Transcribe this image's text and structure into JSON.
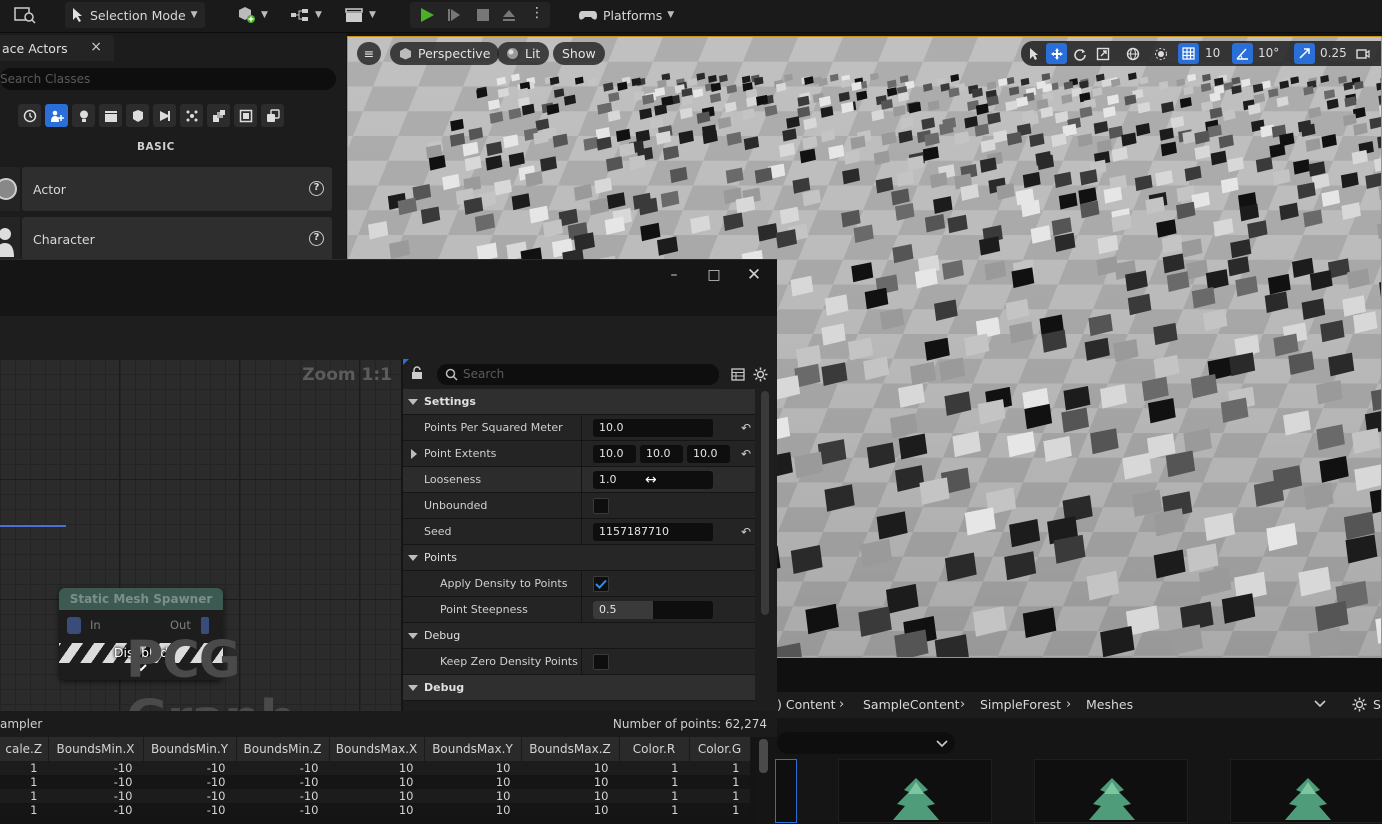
{
  "toolbar": {
    "selection_mode": "Selection Mode",
    "platforms": "Platforms"
  },
  "place_actors": {
    "tab_label": "ace Actors",
    "search_placeholder": "Search Classes",
    "section": "BASIC",
    "items": [
      {
        "label": "Actor"
      },
      {
        "label": "Character"
      }
    ]
  },
  "viewport": {
    "perspective": "Perspective",
    "lit": "Lit",
    "show": "Show",
    "grid_snap": "10",
    "rotation_snap": "10°",
    "scale_snap": "0.25"
  },
  "graph": {
    "zoom": "Zoom 1:1",
    "watermark": "PCG Graph",
    "node": {
      "title": "Static Mesh Spawner",
      "pin_in": "In",
      "pin_out": "Out",
      "state": "Disabled"
    }
  },
  "details": {
    "search_placeholder": "Search",
    "settings_header": "Settings",
    "points_header": "Points",
    "debug_header_1": "Debug",
    "debug_header_2": "Debug",
    "props": {
      "points_per_sq_m": {
        "label": "Points Per Squared Meter",
        "value": "10.0"
      },
      "point_extents": {
        "label": "Point Extents",
        "x": "10.0",
        "y": "10.0",
        "z": "10.0"
      },
      "looseness": {
        "label": "Looseness",
        "value": "1.0"
      },
      "unbounded": {
        "label": "Unbounded",
        "checked": false
      },
      "seed": {
        "label": "Seed",
        "value": "1157187710"
      },
      "apply_density": {
        "label": "Apply Density to Points",
        "checked": true
      },
      "point_steepness": {
        "label": "Point Steepness",
        "value": "0.5",
        "fill": 0.5
      },
      "keep_zero_density": {
        "label": "Keep Zero Density Points",
        "checked": false
      }
    }
  },
  "table": {
    "title": "ampler",
    "count_label": "Number of points: 62,274",
    "columns": [
      "cale.Z",
      "BoundsMin.X",
      "BoundsMin.Y",
      "BoundsMin.Z",
      "BoundsMax.X",
      "BoundsMax.Y",
      "BoundsMax.Z",
      "Color.R",
      "Color.G"
    ],
    "rows": [
      [
        "1",
        "-10",
        "-10",
        "-10",
        "10",
        "10",
        "10",
        "1",
        "1"
      ],
      [
        "1",
        "-10",
        "-10",
        "-10",
        "10",
        "10",
        "10",
        "1",
        "1"
      ],
      [
        "1",
        "-10",
        "-10",
        "-10",
        "10",
        "10",
        "10",
        "1",
        "1"
      ],
      [
        "1",
        "-10",
        "-10",
        "-10",
        "10",
        "10",
        "10",
        "1",
        "1"
      ]
    ]
  },
  "content_browser": {
    "crumbs": [
      ") Content",
      "SampleContent",
      "SimpleForest",
      "Meshes"
    ],
    "settings_partial": "S"
  },
  "colors": {
    "accent_blue": "#2a6ed8",
    "viewport_border": "#c89418",
    "play_green": "#4caf28"
  }
}
